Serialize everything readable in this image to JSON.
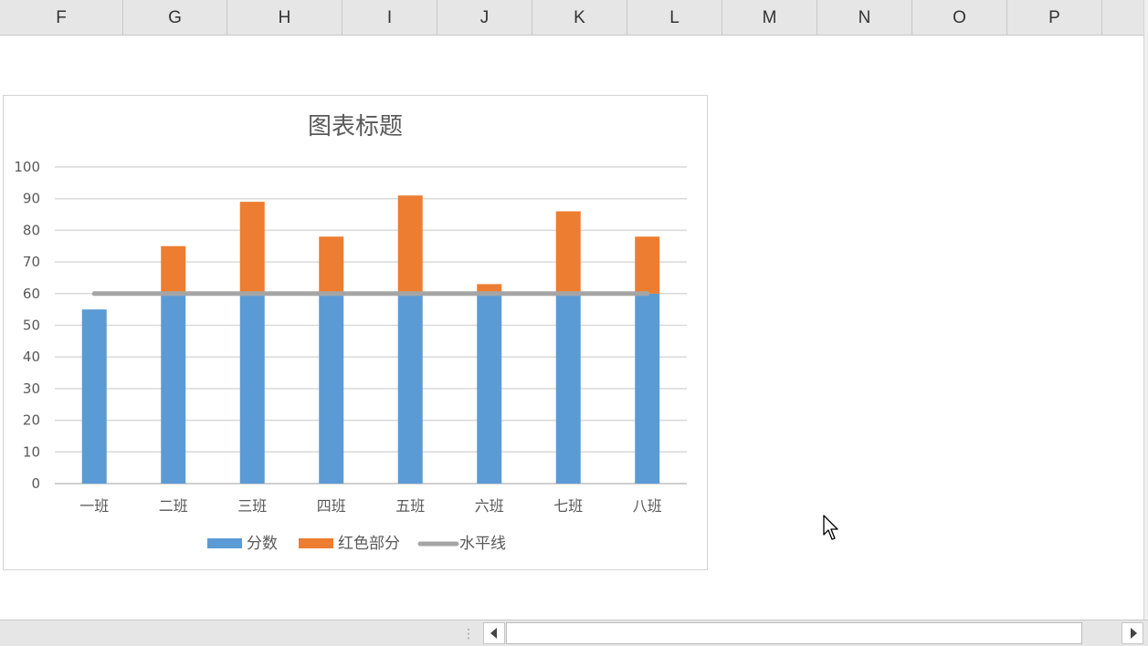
{
  "columns": [
    "F",
    "G",
    "H",
    "I",
    "J",
    "K",
    "L",
    "M",
    "N",
    "O",
    "P"
  ],
  "chart_data": {
    "type": "bar",
    "stacked": true,
    "title": "图表标题",
    "categories": [
      "一班",
      "二班",
      "三班",
      "四班",
      "五班",
      "六班",
      "七班",
      "八班"
    ],
    "series": [
      {
        "name": "分数",
        "type": "bar",
        "color": "#5b9bd5",
        "values": [
          55,
          60,
          60,
          60,
          60,
          60,
          60,
          60
        ]
      },
      {
        "name": "红色部分",
        "type": "bar",
        "color": "#ed7d31",
        "values": [
          0,
          15,
          29,
          18,
          31,
          3,
          26,
          18
        ]
      },
      {
        "name": "水平线",
        "type": "line",
        "color": "#a5a5a5",
        "values": [
          60,
          60,
          60,
          60,
          60,
          60,
          60,
          60
        ]
      }
    ],
    "ylim": [
      0,
      100
    ],
    "yticks": [
      "0",
      "10",
      "20",
      "30",
      "40",
      "50",
      "60",
      "70",
      "80",
      "90",
      "100"
    ],
    "grid": true,
    "legend": "bottom"
  },
  "icons": {
    "scroll_left": "left-arrow-icon",
    "scroll_right": "right-arrow-icon",
    "cursor": "mouse-pointer-icon",
    "grip": "drag-grip-icon"
  }
}
